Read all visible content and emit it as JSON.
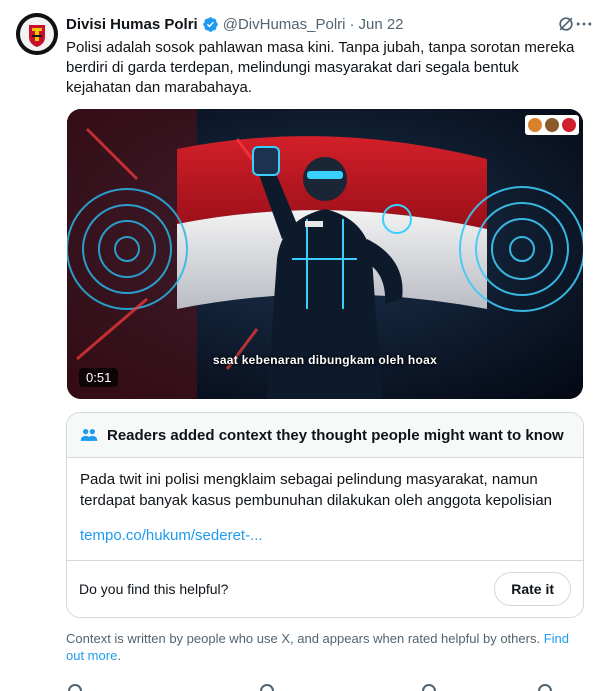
{
  "tweet": {
    "author_name": "Divisi Humas Polri",
    "handle": "@DivHumas_Polri",
    "separator": "·",
    "date": "Jun 22",
    "text": "Polisi adalah sosok pahlawan masa kini. Tanpa jubah, tanpa sorotan mereka berdiri di garda terdepan, melindungi masyarakat dari segala bentuk kejahatan dan marabahaya."
  },
  "media": {
    "subtitle": "saat kebenaran dibungkam oleh hoax",
    "duration": "0:51"
  },
  "community_note": {
    "title": "Readers added context they thought people might want to know",
    "body": "Pada twit ini polisi mengklaim sebagai pelindung masyarakat, namun terdapat banyak kasus pembunuhan dilakukan oleh anggota kepolisian",
    "link": "tempo.co/hukum/sederet-...",
    "helpful_prompt": "Do you find this helpful?",
    "rate_label": "Rate it"
  },
  "footer": {
    "context_text": "Context is written by people who use X, and appears when rated helpful by others.",
    "find_out_more": "Find out more",
    "period": "."
  },
  "colors": {
    "link": "#1d9bf0",
    "verified": "#1d9bf0",
    "secondary_text": "#536471",
    "border": "#cfd9de"
  },
  "icons": [
    "avatar-logo",
    "verified-badge-icon",
    "grok-icon",
    "more-icon",
    "people-icon"
  ]
}
